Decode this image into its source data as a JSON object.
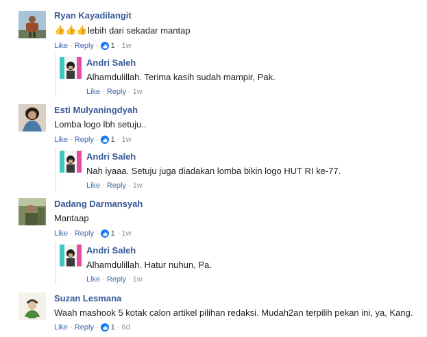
{
  "action_labels": {
    "like": "Like",
    "reply": "Reply",
    "separator": "·"
  },
  "colors": {
    "link": "#4267b2",
    "name": "#385898",
    "meta": "#90949c",
    "like_badge": "#1877f2"
  },
  "comments": [
    {
      "author": "Ryan Kayadilangit",
      "emoji_icons": [
        "thumbs-up-icon",
        "thumbs-up-icon",
        "thumbs-up-icon"
      ],
      "text": "lebih dari sekadar mantap",
      "likes": "1",
      "time": "1w",
      "reply": {
        "author": "Andri Saleh",
        "text": "Alhamdulillah. Terima kasih sudah mampir, Pak.",
        "time": "1w"
      }
    },
    {
      "author": "Esti Mulyaningdyah",
      "text": "Lomba logo lbh setuju..",
      "likes": "1",
      "time": "1w",
      "reply": {
        "author": "Andri Saleh",
        "text": "Nah iyaaa. Setuju juga diadakan lomba bikin logo HUT RI ke-77.",
        "time": "1w"
      }
    },
    {
      "author": "Dadang Darmansyah",
      "text": "Mantaap",
      "likes": "1",
      "time": "1w",
      "reply": {
        "author": "Andri Saleh",
        "text": "Alhamdulillah. Hatur nuhun, Pa.",
        "time": "1w"
      }
    },
    {
      "author": "Suzan Lesmana",
      "text": "Waah mashook 5 kotak calon artikel pilihan redaksi. Mudah2an terpilih pekan ini, ya, Kang.",
      "likes": "1",
      "time": "6d"
    }
  ]
}
